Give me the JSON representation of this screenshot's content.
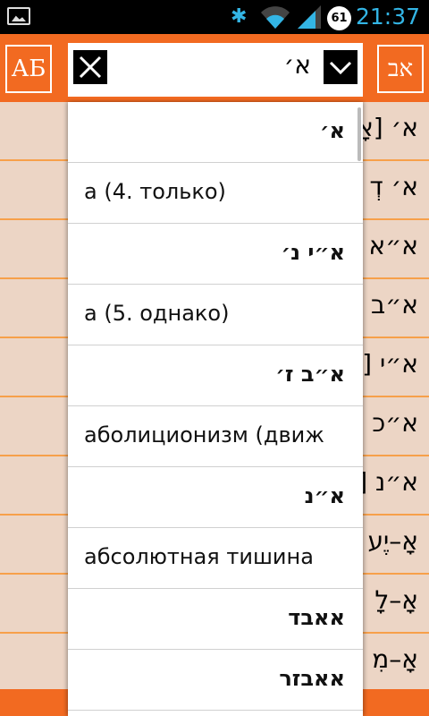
{
  "status_bar": {
    "time": "21:37",
    "battery_level": "61",
    "icons": [
      "image-notification-icon",
      "bluetooth-icon",
      "wifi-icon",
      "signal-icon",
      "battery-icon"
    ]
  },
  "header": {
    "left_button_label": "АБ",
    "right_button_label": "אב",
    "search": {
      "value": "א׳",
      "clear_icon": "close-icon",
      "dropdown_icon": "chevron-down-icon"
    },
    "accent_color": "#f26a21"
  },
  "background_list": {
    "row_color": "#ecd5c5",
    "rows": [
      "א׳ [אָ",
      "א׳ דְ",
      "א״א",
      "א״ב",
      "א״י [",
      "א״כ [",
      "א״נ [",
      "אָ–יֶע",
      "אָ–לָ",
      "אָ–מִ"
    ]
  },
  "dropdown": {
    "items": [
      {
        "text": "א׳",
        "dir": "rtl"
      },
      {
        "text": "а (4. только)",
        "dir": "ltr"
      },
      {
        "text": "א״י נ׳",
        "dir": "rtl"
      },
      {
        "text": "а (5. однако)",
        "dir": "ltr"
      },
      {
        "text": "א״ב ז׳",
        "dir": "rtl"
      },
      {
        "text": "аболиционизм (движ",
        "dir": "ltr"
      },
      {
        "text": "א״נ",
        "dir": "rtl"
      },
      {
        "text": "абсолютная тишина",
        "dir": "ltr"
      },
      {
        "text": "אאבד",
        "dir": "rtl"
      },
      {
        "text": "אאבזר",
        "dir": "rtl"
      }
    ]
  }
}
